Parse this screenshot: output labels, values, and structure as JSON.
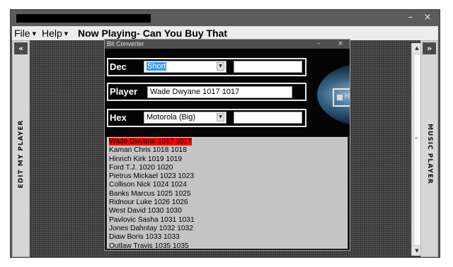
{
  "window": {
    "minimize_icon": "minimize-icon",
    "close_icon": "close-icon",
    "minimize_glyph": "–",
    "close_glyph": "×"
  },
  "menubar": {
    "file_label": "File",
    "help_label": "Help",
    "now_playing": "Now Playing- Can You Buy That"
  },
  "left_panel": {
    "collapse_glyph": "«",
    "label": "EDIT MY PLAYER"
  },
  "right_panel": {
    "expand_glyph": "»",
    "label": "MUSIC PLAYER"
  },
  "dialog": {
    "title": "Bit Converter",
    "minimize_glyph": "–",
    "close_glyph": "×",
    "dec": {
      "label": "Dec",
      "type_value": "Short",
      "value": ""
    },
    "player": {
      "label": "Player",
      "value": "Wade Dwyane 1017 1017"
    },
    "hex": {
      "label": "Hex",
      "type_value": "Motorola (Big)",
      "value": ""
    },
    "checkbox_partial_label": "H",
    "list": [
      "Wade Dwyane 1017 1017",
      "Kaman Chris 1018 1018",
      "Hinrich Kirk 1019 1019",
      "Ford T.J. 1020 1020",
      "Pietrus Mickael 1023 1023",
      "Collison Nick 1024 1024",
      "Banks Marcus 1025 1025",
      "Ridnour Luke 1026 1026",
      "West David 1030 1030",
      "Pavlovic Sasha 1031 1031",
      "Jones Dahntay 1032 1032",
      "Diaw Boris 1033 1033",
      "Outlaw Travis 1035 1035"
    ],
    "selected_index": 0
  },
  "colors": {
    "selection": "#ff0000",
    "accent": "#3399ff"
  }
}
